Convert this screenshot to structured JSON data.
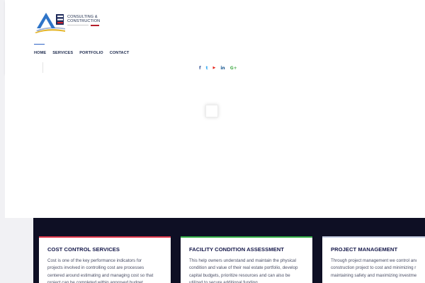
{
  "colors": {
    "accent": "#2f63c5",
    "navy": "#1d2a4d",
    "dark_section": "#0e0f24",
    "card1_line": "#e23a4e",
    "card2_line": "#37b04a",
    "card3_line": "#c4cbe0",
    "facebook": "#3b5998",
    "twitter": "#1da1f2",
    "youtube": "#e62117",
    "linkedin": "#0e4f8b",
    "google_plus": "#4caf50"
  },
  "logo": {
    "line1": "CONSULTING &",
    "line2": "CONSTRUCTION"
  },
  "nav": {
    "items": [
      "HOME",
      "SERVICES",
      "PORTFOLIO",
      "CONTACT"
    ],
    "active": "HOME"
  },
  "social": {
    "icons": [
      "facebook-icon",
      "twitter-icon",
      "youtube-icon",
      "linkedin-icon",
      "google-plus-icon"
    ],
    "glyphs": [
      "f",
      "t",
      "▶",
      "in",
      "G+"
    ]
  },
  "cards": [
    {
      "title": "COST CONTROL SERVICES",
      "text": "Cost is one of the key performance indicators for\nprojects involved in controlling cost are processes\ncentered around estimating and managing cost so that\nproject can be completed within approved budget."
    },
    {
      "title": "FACILITY CONDITION ASSESSMENT",
      "text": "This help owners understand and maintain the physical\ncondition and value of their real estate portfolio, develop\ncapital budgets, prioritize resources and can also be\nutilized to secure additional funding."
    },
    {
      "title": "PROJECT MANAGEMENT",
      "text": "Through project management we control and\nconstruction project to cost and minimizing r\nmaintaining safety and maximizing investment"
    }
  ]
}
